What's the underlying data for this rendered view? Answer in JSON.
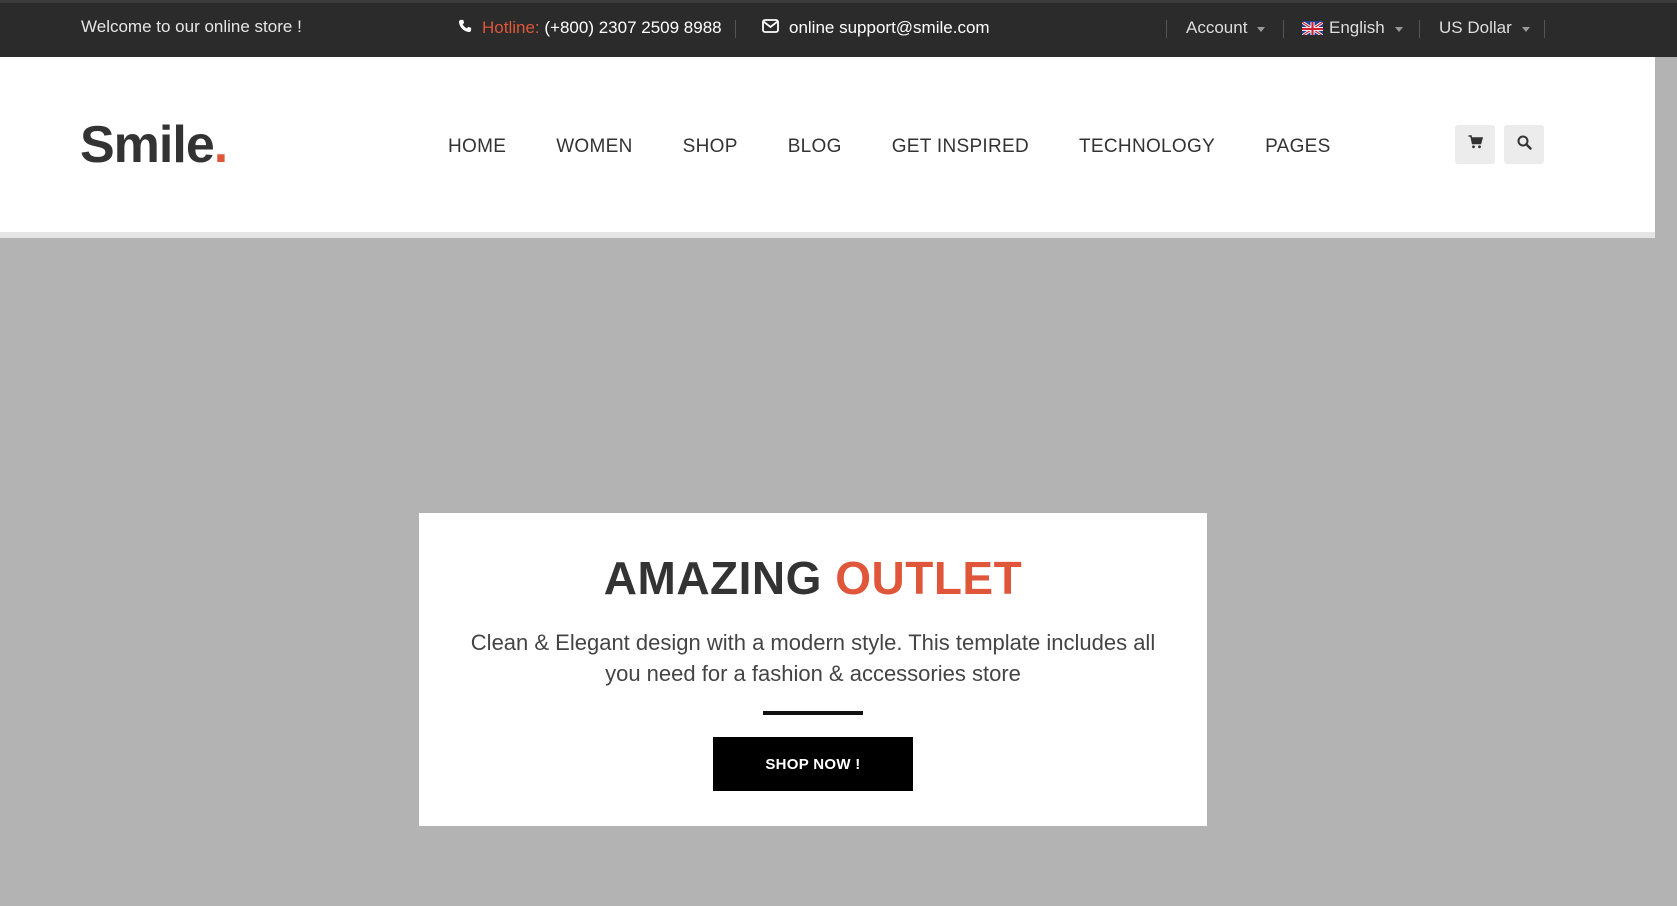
{
  "topbar": {
    "welcome": "Welcome to our online store !",
    "hotline_label": "Hotline:",
    "hotline_number": "(+800) 2307 2509 8988",
    "support_email": "online support@smile.com",
    "account": "Account",
    "language": "English",
    "currency": "US Dollar"
  },
  "header": {
    "logo_text": "Smile",
    "logo_dot": ".",
    "nav": [
      "HOME",
      "WOMEN",
      "SHOP",
      "BLOG",
      "GET INSPIRED",
      "TECHNOLOGY",
      "PAGES"
    ]
  },
  "hero": {
    "title_main": "AMAZING",
    "title_accent": "OUTLET",
    "description": "Clean & Elegant design with a modern style. This template includes all you need for a fashion & accessories store",
    "button": "SHOP NOW !"
  },
  "colors": {
    "accent": "#e0563a",
    "topbar_bg": "#2b2b2b",
    "hero_bg": "#b3b3b3"
  }
}
